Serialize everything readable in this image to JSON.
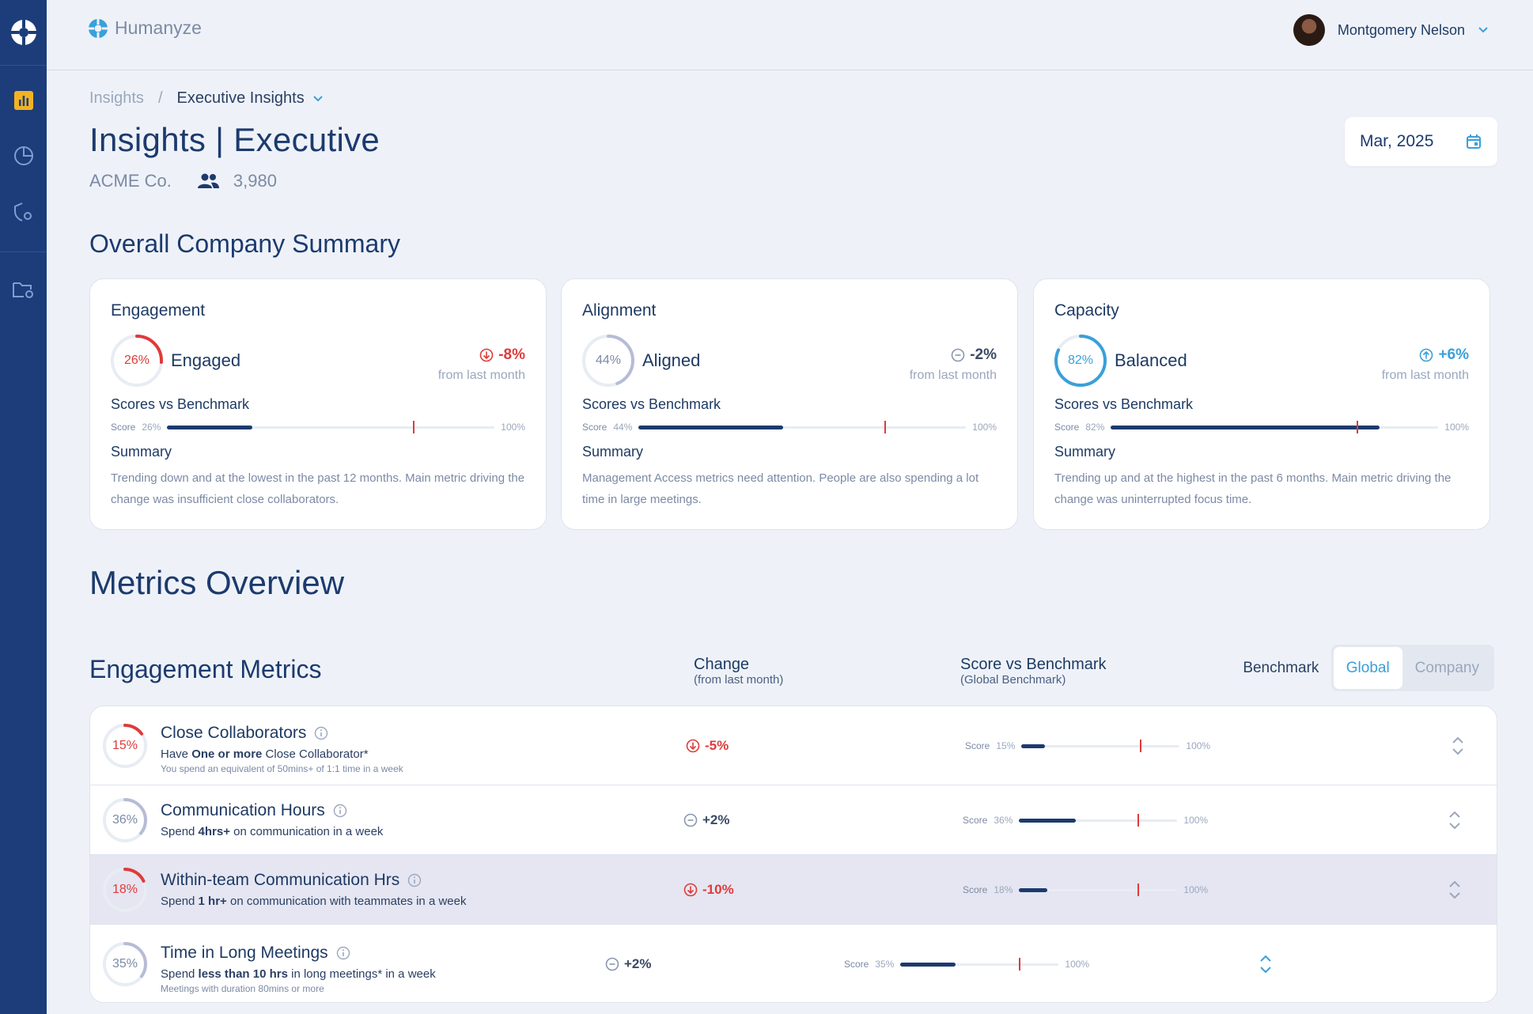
{
  "colors": {
    "sidebar": "#1c3d7a",
    "accent": "#3aa0d8",
    "negative": "#e03a3a",
    "positive": "#3aa0d8",
    "brand_text": "#7c8aa5"
  },
  "brand": {
    "name": "Humanyze"
  },
  "user": {
    "name": "Montgomery Nelson"
  },
  "sidebar": {
    "items": [
      {
        "icon": "bar-chart-icon",
        "active": true
      },
      {
        "icon": "pie-chart-icon",
        "active": false
      },
      {
        "icon": "shield-gear-icon",
        "active": false
      },
      {
        "icon": "folder-gear-icon",
        "active": false
      }
    ]
  },
  "breadcrumb": {
    "root": "Insights",
    "separator": "/",
    "current": "Executive Insights"
  },
  "page": {
    "title": "Insights | Executive",
    "company": "ACME Co.",
    "people_count": "3,980"
  },
  "date_picker": {
    "value": "Mar, 2025"
  },
  "summary": {
    "title": "Overall Company Summary",
    "cards": [
      {
        "title": "Engagement",
        "score": "26%",
        "score_value": 26,
        "status": "Engaged",
        "change": "-8%",
        "change_dir": "down",
        "change_sub": "from last month",
        "svb_label": "Scores vs Benchmark",
        "bar_label": "Score",
        "bar_pct": "26%",
        "bar_end": "100%",
        "benchmark": 75,
        "summary_label": "Summary",
        "summary_text": "Trending down and at the lowest in the past 12 months. Main metric driving the change was insufficient close collaborators."
      },
      {
        "title": "Alignment",
        "score": "44%",
        "score_value": 44,
        "status": "Aligned",
        "change": "-2%",
        "change_dir": "flat",
        "change_sub": "from last month",
        "svb_label": "Scores vs Benchmark",
        "bar_label": "Score",
        "bar_pct": "44%",
        "bar_end": "100%",
        "benchmark": 75,
        "summary_label": "Summary",
        "summary_text": "Management Access metrics need attention. People are also spending a lot time in large meetings."
      },
      {
        "title": "Capacity",
        "score": "82%",
        "score_value": 82,
        "status": "Balanced",
        "change": "+6%",
        "change_dir": "up",
        "change_sub": "from last month",
        "svb_label": "Scores vs Benchmark",
        "bar_label": "Score",
        "bar_pct": "82%",
        "bar_end": "100%",
        "benchmark": 75,
        "summary_label": "Summary",
        "summary_text": "Trending up and at the highest in the past 6 months. Main metric driving the change was uninterrupted focus time."
      }
    ]
  },
  "metrics": {
    "title": "Metrics Overview",
    "group_title": "Engagement Metrics",
    "col_change": "Change",
    "col_change_sub": "(from last month)",
    "col_score": "Score vs Benchmark",
    "col_score_sub": "(Global Benchmark)",
    "benchmark_label": "Benchmark",
    "benchmark_options": [
      "Global",
      "Company"
    ],
    "benchmark_selected": "Global",
    "rows": [
      {
        "name": "Close Collaborators",
        "score": "15%",
        "score_value": 15,
        "desc_pre": "Have ",
        "desc_bold": "One or more",
        "desc_post": " Close Collaborator*",
        "note": "You spend an equivalent of 50mins+ of 1:1 time in a week",
        "change": "-5%",
        "change_dir": "down",
        "bar_label": "Score",
        "bar_pct": "15%",
        "bar_end": "100%",
        "benchmark": 75
      },
      {
        "name": "Communication Hours",
        "score": "36%",
        "score_value": 36,
        "desc_pre": "Spend ",
        "desc_bold": "4hrs+",
        "desc_post": " on communication in a week",
        "note": "",
        "change": "+2%",
        "change_dir": "flat",
        "bar_label": "Score",
        "bar_pct": "36%",
        "bar_end": "100%",
        "benchmark": 75
      },
      {
        "name": "Within-team Communication Hrs",
        "score": "18%",
        "score_value": 18,
        "desc_pre": "Spend ",
        "desc_bold": "1 hr+",
        "desc_post": " on communication with teammates in a week",
        "note": "",
        "change": "-10%",
        "change_dir": "down",
        "bar_label": "Score",
        "bar_pct": "18%",
        "bar_end": "100%",
        "benchmark": 75
      },
      {
        "name": "Time in Long Meetings",
        "score": "35%",
        "score_value": 35,
        "desc_pre": "Spend ",
        "desc_bold": "less than 10 hrs",
        "desc_post": " in long meetings* in a week",
        "note": "Meetings with duration 80mins or more",
        "change": "+2%",
        "change_dir": "flat",
        "bar_label": "Score",
        "bar_pct": "35%",
        "bar_end": "100%",
        "benchmark": 75
      }
    ]
  }
}
